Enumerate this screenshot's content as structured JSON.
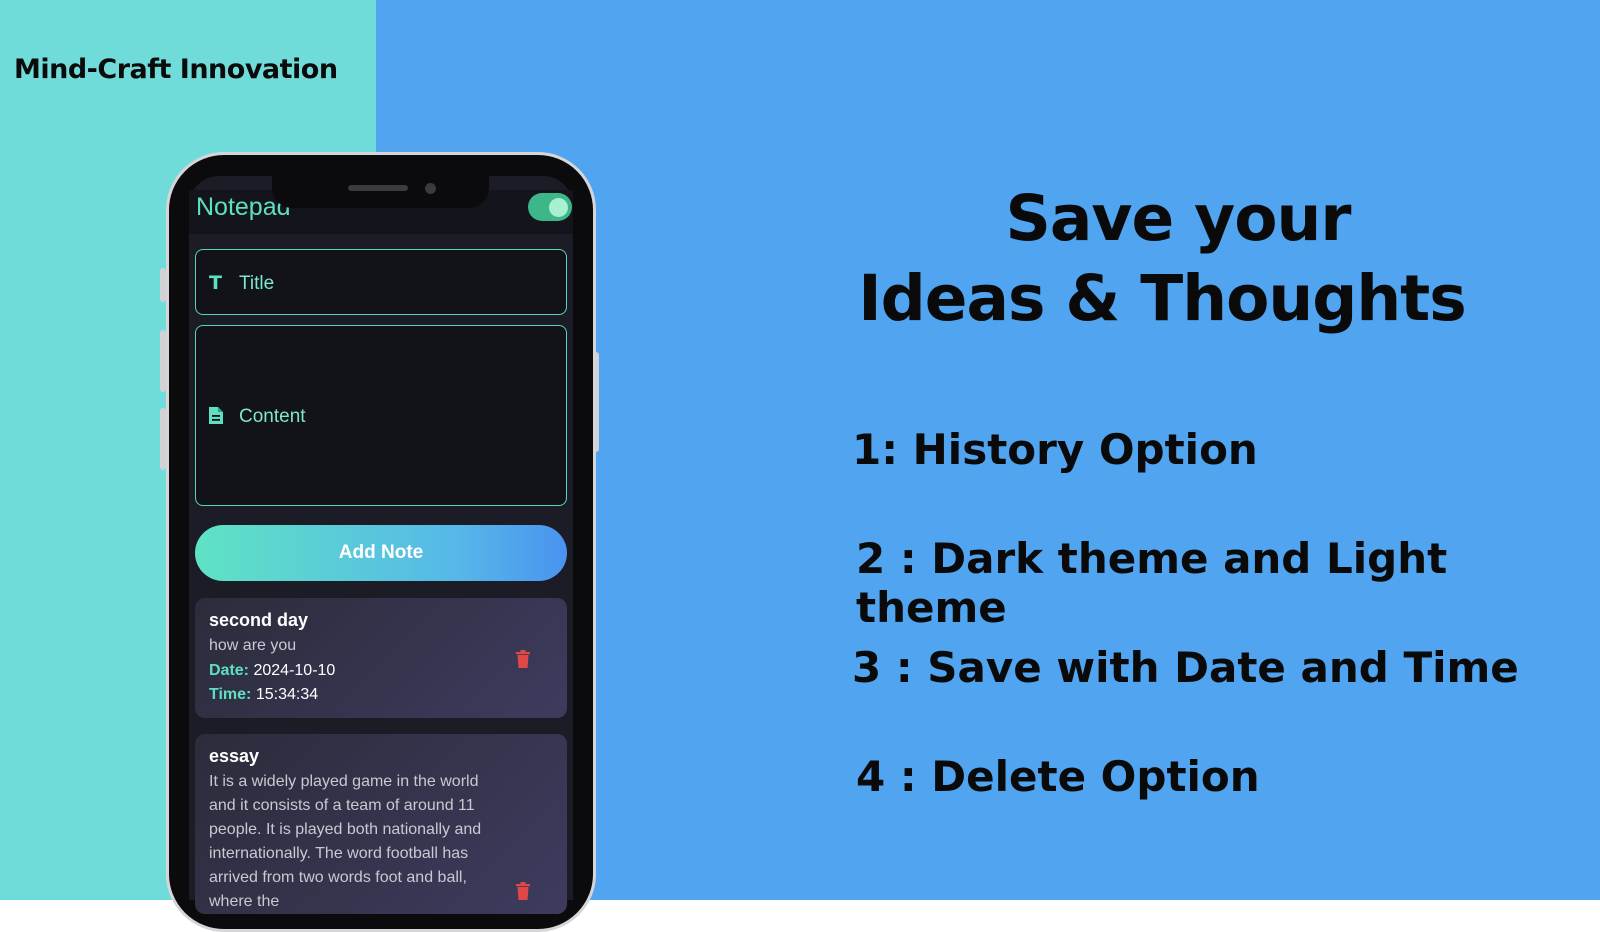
{
  "brand": "Mind-Craft Innovation",
  "app": {
    "title": "Notepad",
    "theme_toggle_on": true,
    "title_placeholder": "Title",
    "content_placeholder": "Content",
    "add_button": "Add Note",
    "date_key": "Date:",
    "time_key": "Time:"
  },
  "notes": [
    {
      "title": "second day",
      "content": "how are you",
      "date": "2024-10-10",
      "time": "15:34:34"
    },
    {
      "title": "essay",
      "content": "It is a widely played game in the world and it consists of a team of around 11 people. It is played both nationally and internationally. The word football has arrived from two words foot and ball, where the"
    }
  ],
  "headline": {
    "line1": "Save your",
    "line2": "Ideas & Thoughts"
  },
  "features": [
    "1: History Option",
    "2 : Dark theme and Light theme",
    "3 : Save with Date and Time",
    "4 : Delete Option"
  ],
  "colors": {
    "left_bg": "#6fdcd9",
    "right_bg": "#50a4f0",
    "accent": "#5ee0c0"
  },
  "icons": {
    "title_field": "text-format-icon",
    "content_field": "document-icon",
    "delete": "trash-icon"
  }
}
